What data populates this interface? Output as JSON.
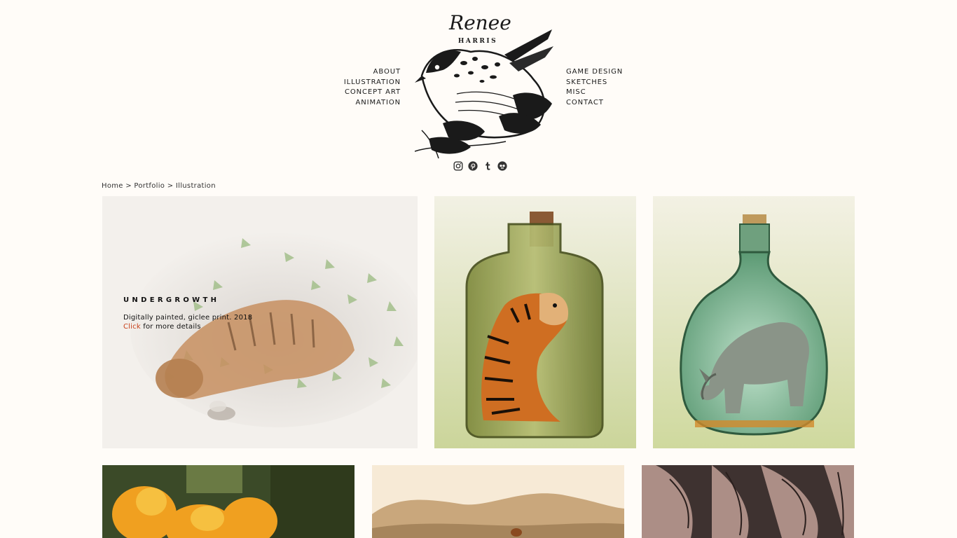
{
  "header": {
    "logo_name": "Renee",
    "logo_surname": "HARRIS",
    "nav_left": [
      "ABOUT",
      "ILLUSTRATION",
      "CONCEPT ART",
      "ANIMATION"
    ],
    "nav_right": [
      "GAME DESIGN",
      "SKETCHES",
      "MISC",
      "CONTACT"
    ],
    "social_icons": [
      "instagram-icon",
      "pinterest-icon",
      "tumblr-icon",
      "redbubble-icon"
    ]
  },
  "breadcrumb": {
    "home": "Home",
    "sep1": ">",
    "portfolio": "Portfolio",
    "sep2": ">",
    "current": "Illustration"
  },
  "gallery": {
    "featured": {
      "title": "UNDERGROWTH",
      "description": "Digitally painted, giclee print. 2018",
      "click_label": "Click",
      "more_label": "for more details"
    },
    "items": [
      "tiger-in-bottle",
      "rhino-in-bottle",
      "orange-flowers",
      "desert-landscape",
      "furry-creature"
    ]
  },
  "colors": {
    "background": "#fffcf8",
    "link_accent": "#c8401a"
  }
}
